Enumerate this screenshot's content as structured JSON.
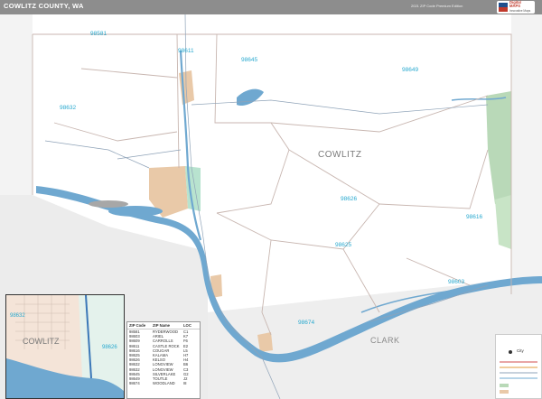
{
  "header": {
    "title": "COWLITZ COUNTY, WA",
    "edition": "2021 ZIP Code Premium Edition",
    "logo_line1": "Digital",
    "logo_line2": "MAPS",
    "logo_line3": "Innovative Maps"
  },
  "map": {
    "county_label": "COWLITZ",
    "neighbor_label": "CLARK",
    "zip_labels": [
      "98581",
      "98611",
      "98645",
      "98649",
      "98632",
      "98626",
      "98616",
      "98625",
      "98603",
      "98674"
    ],
    "colors": {
      "water": "#6fa8d0",
      "park": "#b9d9b8",
      "city_tan": "#e9c9a8",
      "city_green": "#b8e3cf",
      "zip_label": "#29a9cf",
      "boundary": "#c8b6b0"
    }
  },
  "inset": {
    "county_label": "COWLITZ",
    "zip_labels": [
      "98632",
      "98626"
    ]
  },
  "legend": {
    "headers": [
      "ZIP Code",
      "ZIP Name",
      "LOC"
    ],
    "rows": [
      [
        "98581",
        "RYDERWOOD",
        "C1"
      ],
      [
        "98603",
        "ARIEL",
        "K7"
      ],
      [
        "98609",
        "CARROLLS",
        "F6"
      ],
      [
        "98611",
        "CASTLE ROCK",
        "E2"
      ],
      [
        "98616",
        "COUGAR",
        "L5"
      ],
      [
        "98625",
        "KALAMA",
        "H7"
      ],
      [
        "98626",
        "KELSO",
        "H4"
      ],
      [
        "98632",
        "LONGVIEW",
        "B6"
      ],
      [
        "98632",
        "LONGVIEW",
        "C3"
      ],
      [
        "98645",
        "SILVERLAKE",
        "G2"
      ],
      [
        "98649",
        "TOUTLE",
        "J2"
      ],
      [
        "98674",
        "WOODLAND",
        "I8"
      ]
    ]
  },
  "key": {
    "city_label": "City"
  }
}
